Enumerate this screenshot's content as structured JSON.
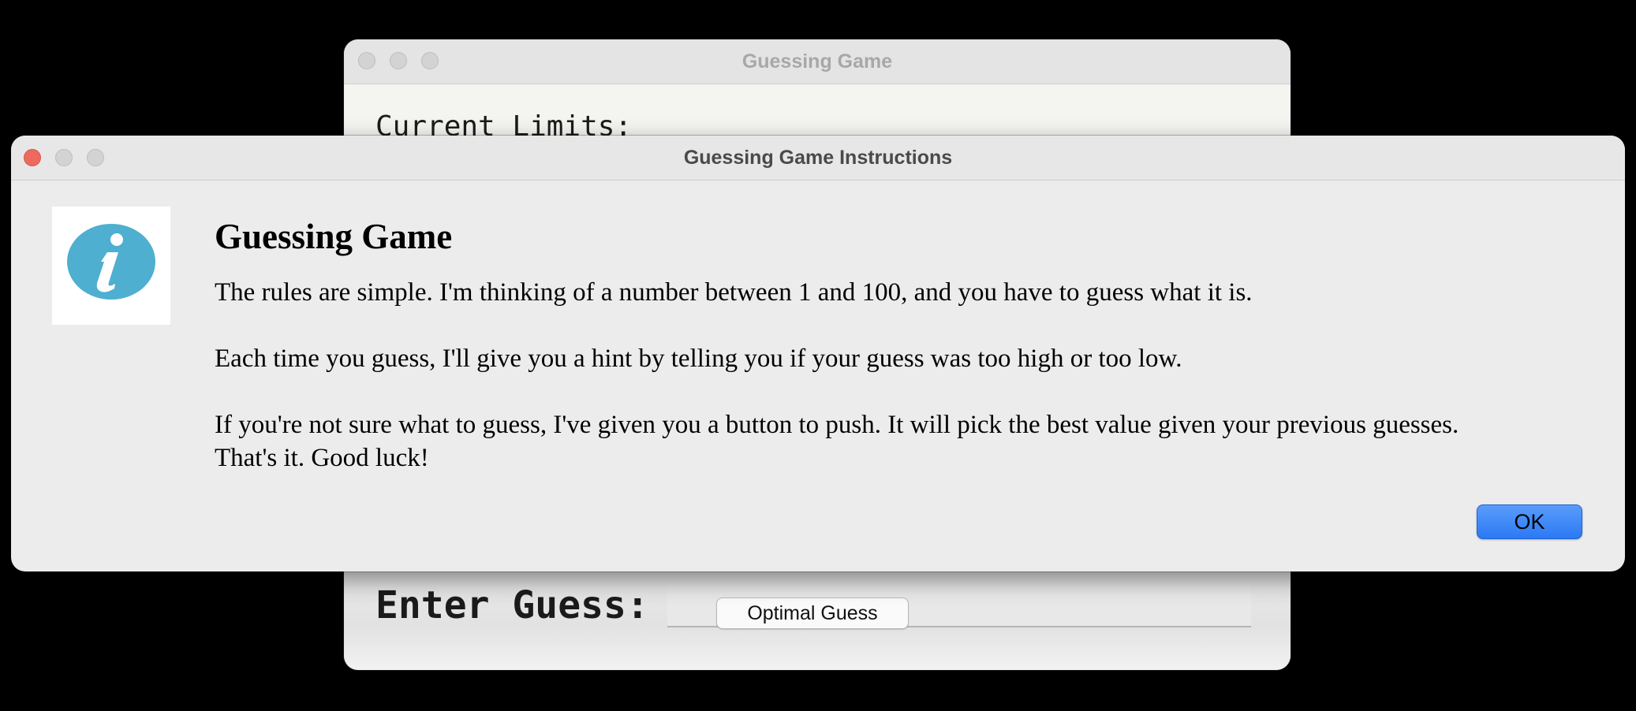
{
  "background_window": {
    "title": "Guessing Game",
    "limits_label": "Current Limits:",
    "enter_label": "Enter Guess:",
    "optimal_button_label": "Optimal Guess"
  },
  "dialog": {
    "title": "Guessing Game Instructions",
    "heading": "Guessing Game",
    "paragraphs": {
      "p1": "The rules are simple. I'm thinking of a number between 1 and 100, and you have to guess what it is.",
      "p2": "Each time you guess, I'll give you a hint by telling you if your guess was too high or too low.",
      "p3_line1": "If you're not sure what to guess, I've given you a button to push. It will pick the best value given your previous guesses.",
      "p3_line2": "That's it. Good luck!"
    },
    "ok_label": "OK",
    "icon": "info-icon"
  },
  "colors": {
    "close_red": "#ed6a5e",
    "info_blue": "#4eafd0",
    "ok_blue": "#2b79f4"
  }
}
